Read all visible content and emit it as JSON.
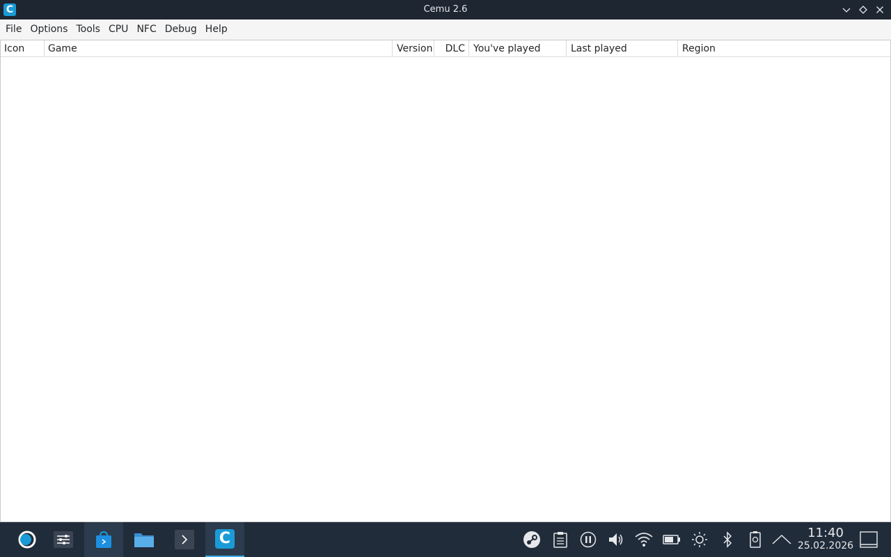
{
  "window": {
    "title": "Cemu 2.6",
    "app_icon_letter": "C"
  },
  "menu": [
    "File",
    "Options",
    "Tools",
    "CPU",
    "NFC",
    "Debug",
    "Help"
  ],
  "table": {
    "columns": [
      "Icon",
      "Game",
      "Version",
      "DLC",
      "You've played",
      "Last played",
      "Region"
    ],
    "rows": []
  },
  "taskbar": {
    "apps": [
      "application-launcher-icon",
      "system-settings-icon",
      "discover-store-icon",
      "file-manager-icon",
      "terminal-icon",
      "cemu-icon"
    ],
    "cemu_letter": "C",
    "tray": [
      "steam-icon",
      "clipboard-icon",
      "media-pause-icon",
      "volume-icon",
      "wifi-icon",
      "battery-icon",
      "brightness-icon",
      "bluetooth-icon",
      "device-status-icon",
      "show-hidden-icon"
    ],
    "clock": {
      "time": "11:40",
      "date": "25.02.2026"
    }
  },
  "colors": {
    "titlebar": "#1e2632",
    "taskbar": "#212c3a",
    "accent": "#1a9bd7"
  }
}
